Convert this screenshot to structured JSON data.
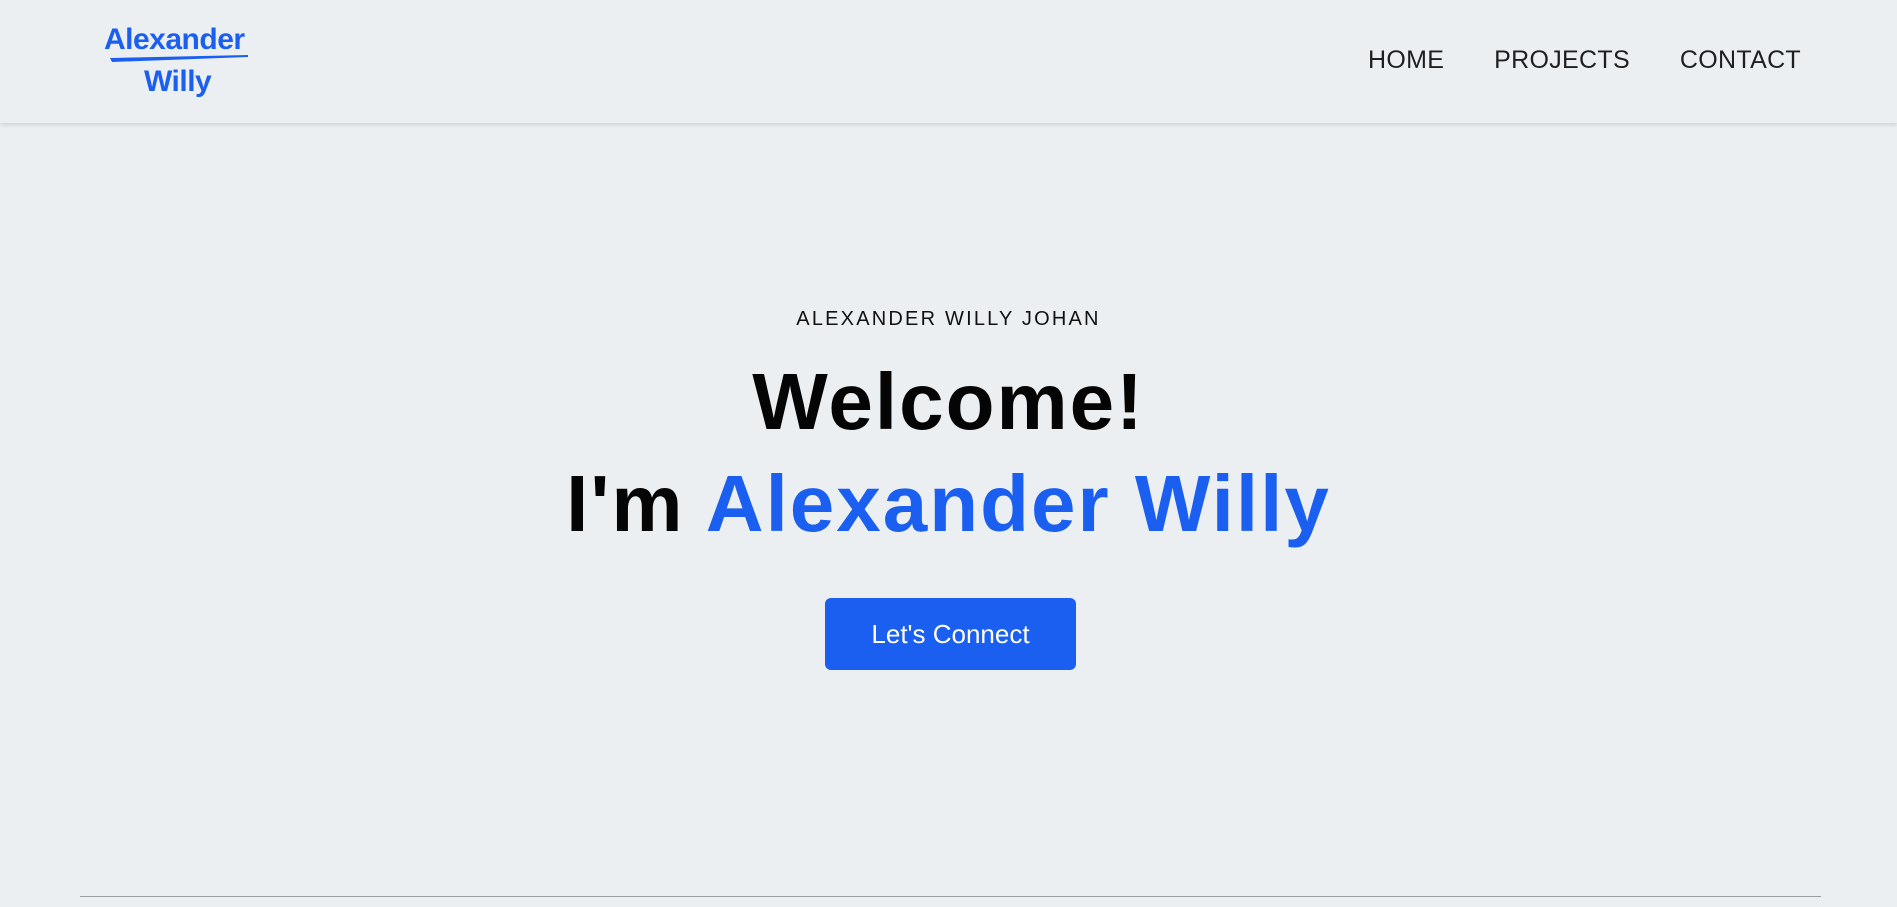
{
  "header": {
    "logo": {
      "line1": "Alexander",
      "line2": "Willy"
    },
    "nav": [
      {
        "label": "HOME"
      },
      {
        "label": "PROJECTS"
      },
      {
        "label": "CONTACT"
      }
    ]
  },
  "hero": {
    "eyebrow": "ALEXANDER WILLY JOHAN",
    "headline_line1": "Welcome!",
    "headline_prefix": "I'm",
    "headline_name": "Alexander Willy",
    "cta_label": "Let's Connect"
  },
  "colors": {
    "accent": "#1a5ff0",
    "background": "#eceff2",
    "text": "#050505"
  }
}
